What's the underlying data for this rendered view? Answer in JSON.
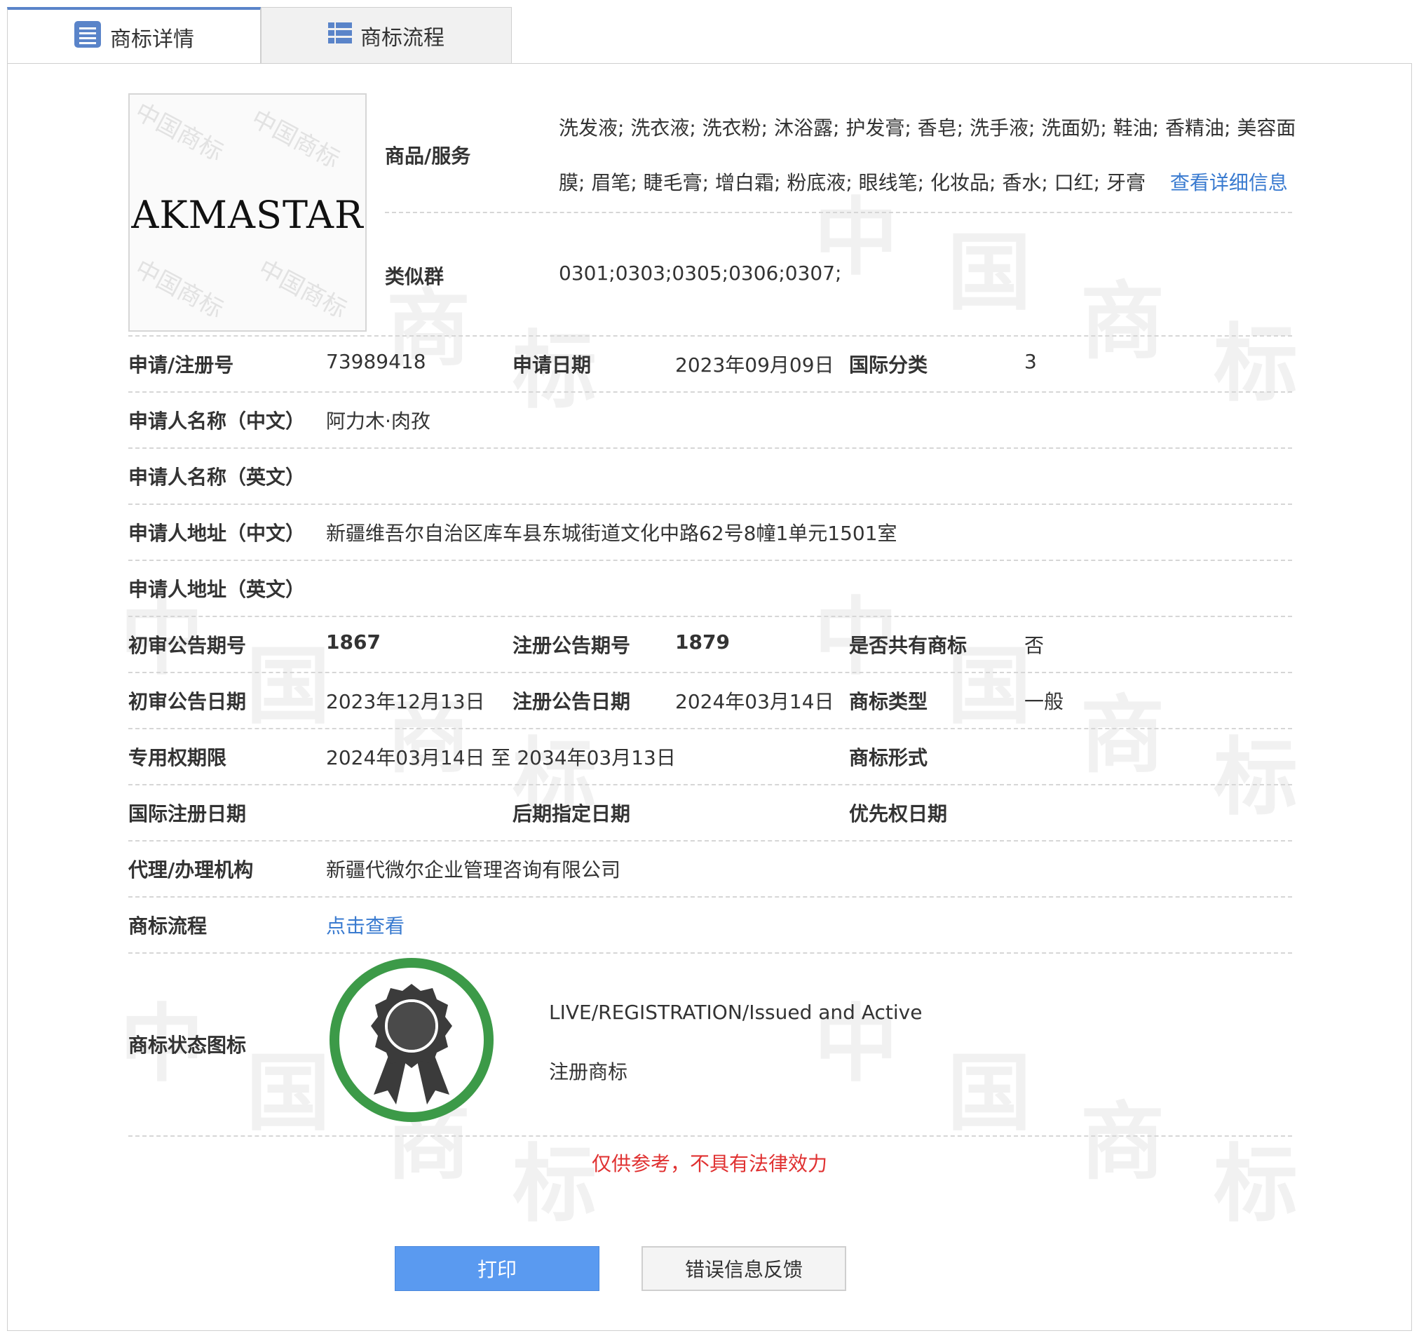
{
  "tabs": [
    {
      "label": "商标详情",
      "icon": "list-icon"
    },
    {
      "label": "商标流程",
      "icon": "grid-icon"
    }
  ],
  "logo": {
    "text": "AKMASTAR",
    "watermark": "中国商标"
  },
  "goods": {
    "label": "商品/服务",
    "line1": "洗发液; 洗衣液; 洗衣粉; 沐浴露; 护发膏; 香皂; 洗手液; 洗面奶; 鞋油; 香精油; 美容面",
    "line2": "膜; 眉笔; 睫毛膏; 增白霜; 粉底液; 眼线笔; 化妆品; 香水; 口红; 牙膏",
    "more_link": "查看详细信息"
  },
  "similar_group": {
    "label": "类似群",
    "value": "0301;0303;0305;0306;0307;"
  },
  "fields": {
    "reg_no_label": "申请/注册号",
    "reg_no": "73989418",
    "apply_date_label": "申请日期",
    "apply_date": "2023年09月09日",
    "intl_class_label": "国际分类",
    "intl_class": "3",
    "applicant_cn_label": "申请人名称（中文）",
    "applicant_cn": "阿力木·肉孜",
    "applicant_en_label": "申请人名称（英文）",
    "applicant_en": "",
    "address_cn_label": "申请人地址（中文）",
    "address_cn": "新疆维吾尔自治区库车县东城街道文化中路62号8幢1单元1501室",
    "address_en_label": "申请人地址（英文）",
    "address_en": "",
    "prelim_no_label": "初审公告期号",
    "prelim_no": "1867",
    "reg_pub_no_label": "注册公告期号",
    "reg_pub_no": "1879",
    "shared_label": "是否共有商标",
    "shared": "否",
    "prelim_date_label": "初审公告日期",
    "prelim_date": "2023年12月13日",
    "reg_pub_date_label": "注册公告日期",
    "reg_pub_date": "2024年03月14日",
    "tm_type_label": "商标类型",
    "tm_type": "一般",
    "term_label": "专用权期限",
    "term": "2024年03月14日 至 2034年03月13日",
    "tm_form_label": "商标形式",
    "tm_form": "",
    "intl_reg_date_label": "国际注册日期",
    "intl_reg_date": "",
    "later_date_label": "后期指定日期",
    "later_date": "",
    "priority_date_label": "优先权日期",
    "priority_date": "",
    "agent_label": "代理/办理机构",
    "agent": "新疆代微尔企业管理咨询有限公司",
    "flow_label": "商标流程",
    "flow_link": "点击查看",
    "status_icon_label": "商标状态图标",
    "status_en": "LIVE/REGISTRATION/Issued and Active",
    "status_cn": "注册商标"
  },
  "note": "仅供参考，不具有法律效力",
  "buttons": {
    "print": "打印",
    "feedback": "错误信息反馈"
  },
  "colors": {
    "accent": "#5a84c9",
    "link": "#3a7bd0",
    "warning": "#e03131",
    "badge_ring": "#3c9a48",
    "print_button": "#5a9af0"
  }
}
